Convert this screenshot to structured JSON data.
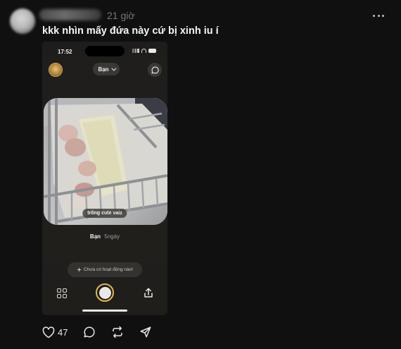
{
  "post": {
    "time": "21 giờ",
    "caption": "kkk nhìn mấy đứa này cứ bị xinh iu í",
    "likes": "47"
  },
  "screenshot": {
    "status_time": "17:52",
    "audience_label": "Bạn",
    "photo_caption": "trông cute vaiz",
    "sender": "Bạn",
    "sent_ago": "5ngày",
    "activity_prompt": "Chưa có hoạt động nào!"
  },
  "icons": {
    "more": "more-horizontal-icon",
    "like": "heart-icon",
    "reply": "comment-icon",
    "repost": "repost-icon",
    "share": "send-icon"
  },
  "colors": {
    "background": "#101010",
    "accent_ring": "#e6b84a"
  }
}
